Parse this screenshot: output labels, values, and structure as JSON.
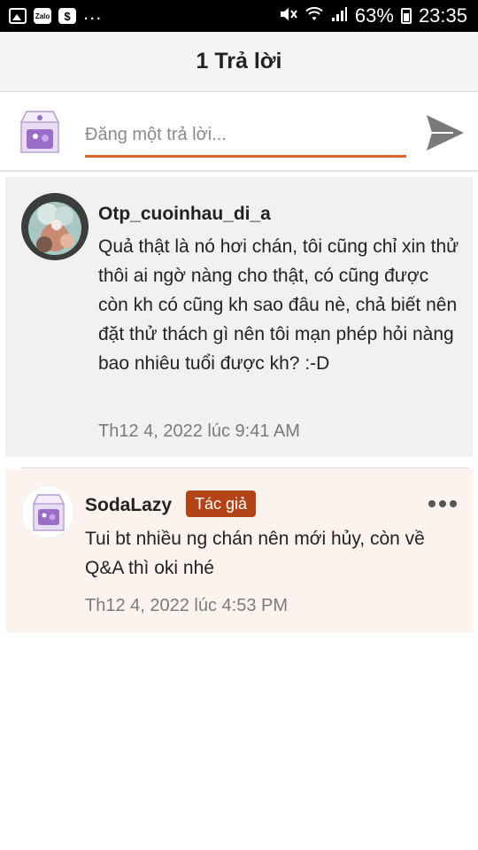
{
  "status_bar": {
    "icons_left": [
      "image-icon",
      "zalo-icon",
      "dollar-icon",
      "more-notifications-icon"
    ],
    "more_label": "...",
    "zalo_label": "Zalo",
    "dollar_label": "$",
    "battery": "63%",
    "time": "23:35"
  },
  "header": {
    "title": "1 Trả lời"
  },
  "reply": {
    "placeholder": "Đăng một trả lời...",
    "accent_color": "#e0652a"
  },
  "comments": [
    {
      "user": "Otp_cuoinhau_di_a",
      "text": "Quả thật là nó hơi chán, tôi cũng chỉ xin thử thôi ai ngờ nàng cho thật, có cũng được còn kh có cũng kh sao đâu nè, chả biết nên đặt thử thách gì nên tôi mạn phép hỏi nàng bao nhiêu tuổi được kh? :-D",
      "time": "Th12 4, 2022 lúc 9:41 AM"
    },
    {
      "user": "SodaLazy",
      "badge": "Tác giả",
      "text": "Tui bt nhiều ng chán nên mới hủy, còn về Q&A thì oki nhé",
      "time": "Th12 4, 2022 lúc 4:53 PM"
    }
  ],
  "colors": {
    "badge_bg": "#b34418",
    "author_comment_bg": "#fdf3ee",
    "comment_bg": "#f1f1f1"
  }
}
